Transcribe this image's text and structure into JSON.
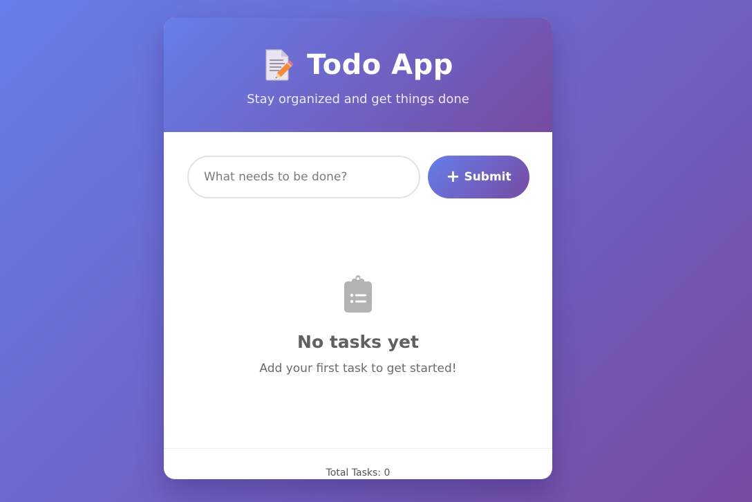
{
  "header": {
    "title": "Todo App",
    "subtitle": "Stay organized and get things done",
    "icon": "memo-pencil-icon"
  },
  "add_form": {
    "input_placeholder": "What needs to be done?",
    "input_value": "",
    "submit_label": "Submit",
    "submit_icon": "+"
  },
  "empty_state": {
    "icon": "clipboard-list-icon",
    "title": "No tasks yet",
    "message": "Add your first task to get started!"
  },
  "footer": {
    "total_label": "Total Tasks: 0"
  },
  "colors": {
    "gradient_start": "#667eea",
    "gradient_end": "#764ba2",
    "empty_icon": "#b3b3b3"
  }
}
